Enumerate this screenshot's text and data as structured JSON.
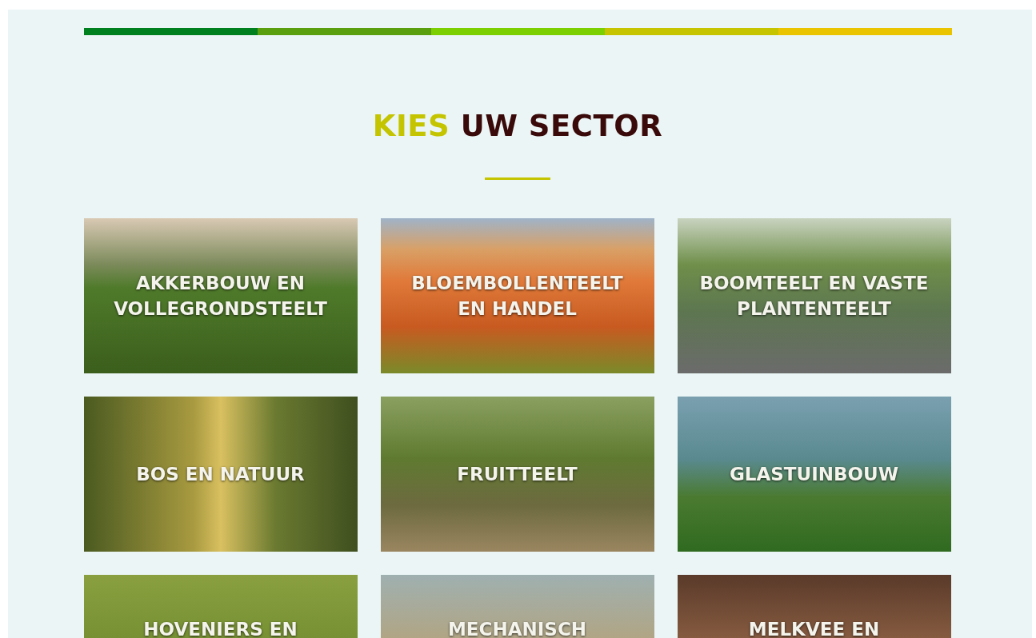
{
  "stripe": [
    {
      "color": "#00801f"
    },
    {
      "color": "#5aa00e"
    },
    {
      "color": "#7ccf00"
    },
    {
      "color": "#c6c400"
    },
    {
      "color": "#ebc400"
    }
  ],
  "heading": {
    "accent": "KIES",
    "rest": "UW SECTOR"
  },
  "sectors": [
    {
      "label": "AKKERBOUW EN VOLLEGRONDSTEELT"
    },
    {
      "label": "BLOEMBOLLENTEELT EN HANDEL"
    },
    {
      "label": "BOOMTEELT EN VASTE PLANTENTEELT"
    },
    {
      "label": "BOS EN NATUUR"
    },
    {
      "label": "FRUITTEELT"
    },
    {
      "label": "GLASTUINBOUW"
    },
    {
      "label": "HOVENIERS EN"
    },
    {
      "label": "MECHANISCH"
    },
    {
      "label": "MELKVEE EN"
    }
  ]
}
